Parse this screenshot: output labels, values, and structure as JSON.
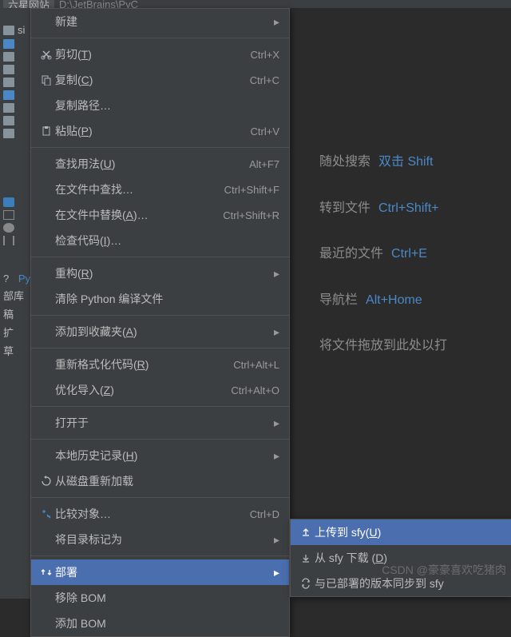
{
  "tab": {
    "left": "六星网站",
    "right": "D:\\JetBrains\\PyC"
  },
  "project": {
    "root": "si",
    "items": [
      "",
      "",
      "",
      "",
      "",
      "",
      "",
      "",
      "",
      "",
      ""
    ]
  },
  "py_label": "Py",
  "bottom_labels": [
    "部库",
    "稿",
    "扩",
    "草"
  ],
  "hints": [
    {
      "label": "随处搜索",
      "shortcut": "双击 Shift"
    },
    {
      "label": "转到文件",
      "shortcut": "Ctrl+Shift+"
    },
    {
      "label": "最近的文件",
      "shortcut": "Ctrl+E"
    },
    {
      "label": "导航栏",
      "shortcut": "Alt+Home"
    },
    {
      "label": "将文件拖放到此处以打",
      "shortcut": ""
    }
  ],
  "menu": {
    "new": "新建",
    "cut": "剪切(T)",
    "cut_s": "Ctrl+X",
    "copy": "复制(C)",
    "copy_s": "Ctrl+C",
    "copypath": "复制路径…",
    "paste": "粘贴(P)",
    "paste_s": "Ctrl+V",
    "findusages": "查找用法(U)",
    "findusages_s": "Alt+F7",
    "findinfiles": "在文件中查找…",
    "findinfiles_s": "Ctrl+Shift+F",
    "replaceinfiles": "在文件中替换(A)…",
    "replaceinfiles_s": "Ctrl+Shift+R",
    "inspect": "检查代码(I)…",
    "refactor": "重构(R)",
    "cleanpyc": "清除 Python 编译文件",
    "addtofav": "添加到收藏夹(A)",
    "reformat": "重新格式化代码(R)",
    "reformat_s": "Ctrl+Alt+L",
    "optimport": "优化导入(Z)",
    "optimport_s": "Ctrl+Alt+O",
    "openin": "打开于",
    "localhist": "本地历史记录(H)",
    "reloaddisk": "从磁盘重新加载",
    "compare": "比较对象…",
    "compare_s": "Ctrl+D",
    "markdir": "将目录标记为",
    "deploy": "部署",
    "removebom": "移除 BOM",
    "addbom": "添加 BOM"
  },
  "submenu": {
    "upload": "上传到 sfy(U)",
    "download": "从 sfy 下载 (D)",
    "sync": "与已部署的版本同步到 sfy"
  },
  "watermark": "CSDN @豪豪喜欢吃猪肉"
}
